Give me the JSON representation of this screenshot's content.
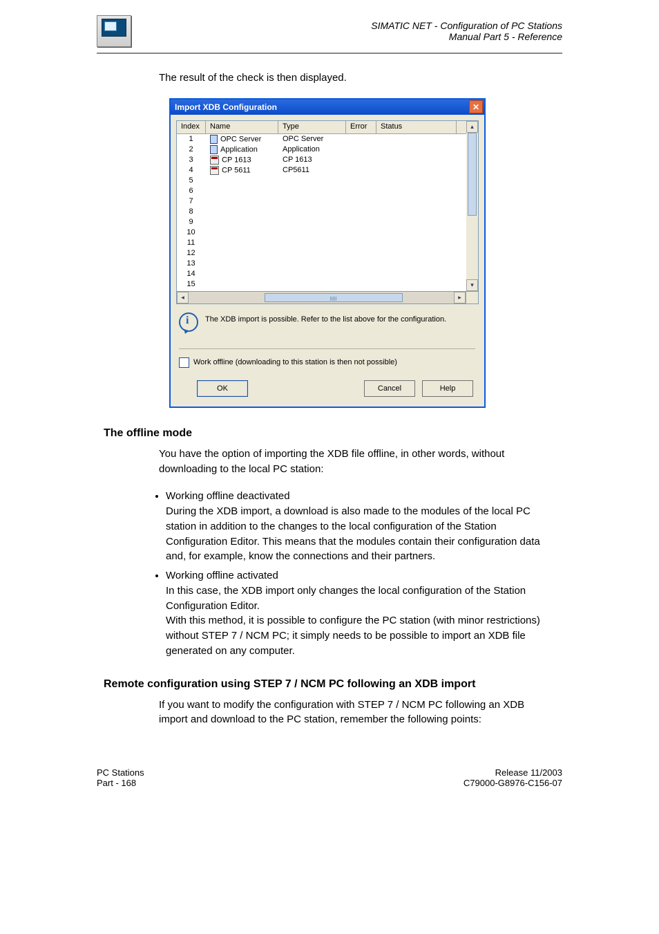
{
  "header": {
    "title_line1": "SIMATIC NET - Configuration of PC Stations",
    "title_line2": "Manual Part 5 - Reference"
  },
  "intro": "The result of the check is then displayed.",
  "dialog": {
    "title": "Import XDB Configuration",
    "columns": [
      "Index",
      "Name",
      "Type",
      "Error",
      "Status"
    ],
    "rows": [
      {
        "index": "1",
        "name": "OPC Server",
        "type": "OPC Server",
        "icon": "sq"
      },
      {
        "index": "2",
        "name": "Application",
        "type": "Application",
        "icon": "sq"
      },
      {
        "index": "3",
        "name": "CP 1613",
        "type": "CP 1613",
        "icon": "net"
      },
      {
        "index": "4",
        "name": "CP 5611",
        "type": "CP5611",
        "icon": "net"
      },
      {
        "index": "5"
      },
      {
        "index": "6"
      },
      {
        "index": "7"
      },
      {
        "index": "8"
      },
      {
        "index": "9"
      },
      {
        "index": "10"
      },
      {
        "index": "11"
      },
      {
        "index": "12"
      },
      {
        "index": "13"
      },
      {
        "index": "14"
      },
      {
        "index": "15"
      }
    ],
    "message": "The XDB import is possible. Refer to the list above for the configuration.",
    "checkbox_label": "Work offline (downloading to this station is then not possible)",
    "buttons": {
      "ok": "OK",
      "cancel": "Cancel",
      "help": "Help"
    }
  },
  "offline_heading": "The offline mode",
  "offline_p1": "You have the option of importing the XDB file offline, in other words, without downloading to the local PC station:",
  "offline_bullet1a": "Working offline deactivated",
  "offline_bullet1b": "During the XDB import, a download is also made to the modules of the local PC station in addition to the changes to the local configuration of the Station Configuration Editor. This means that the modules contain their configuration data and, for example, know the connections and their partners.",
  "offline_bullet2a": "Working offline activated",
  "offline_bullet2b": "In this case, the XDB import only changes the local configuration of the Station Configuration Editor.",
  "offline_bullet2c": "With this method, it is possible to configure the PC station (with minor restrictions) without STEP 7 / NCM PC; it simply needs to be possible to import an XDB file generated on any computer.",
  "remote_heading": "Remote configuration using STEP 7 / NCM PC following an XDB import",
  "remote_p": "If you want to modify the configuration with STEP 7 / NCM PC following an XDB import and download to the PC station, remember the following points:",
  "footer": {
    "left_line1": "PC Stations",
    "left_line2": "Part - 168",
    "right_line1": "Release 11/2003",
    "right_line2": "C79000-G8976-C156-07"
  }
}
